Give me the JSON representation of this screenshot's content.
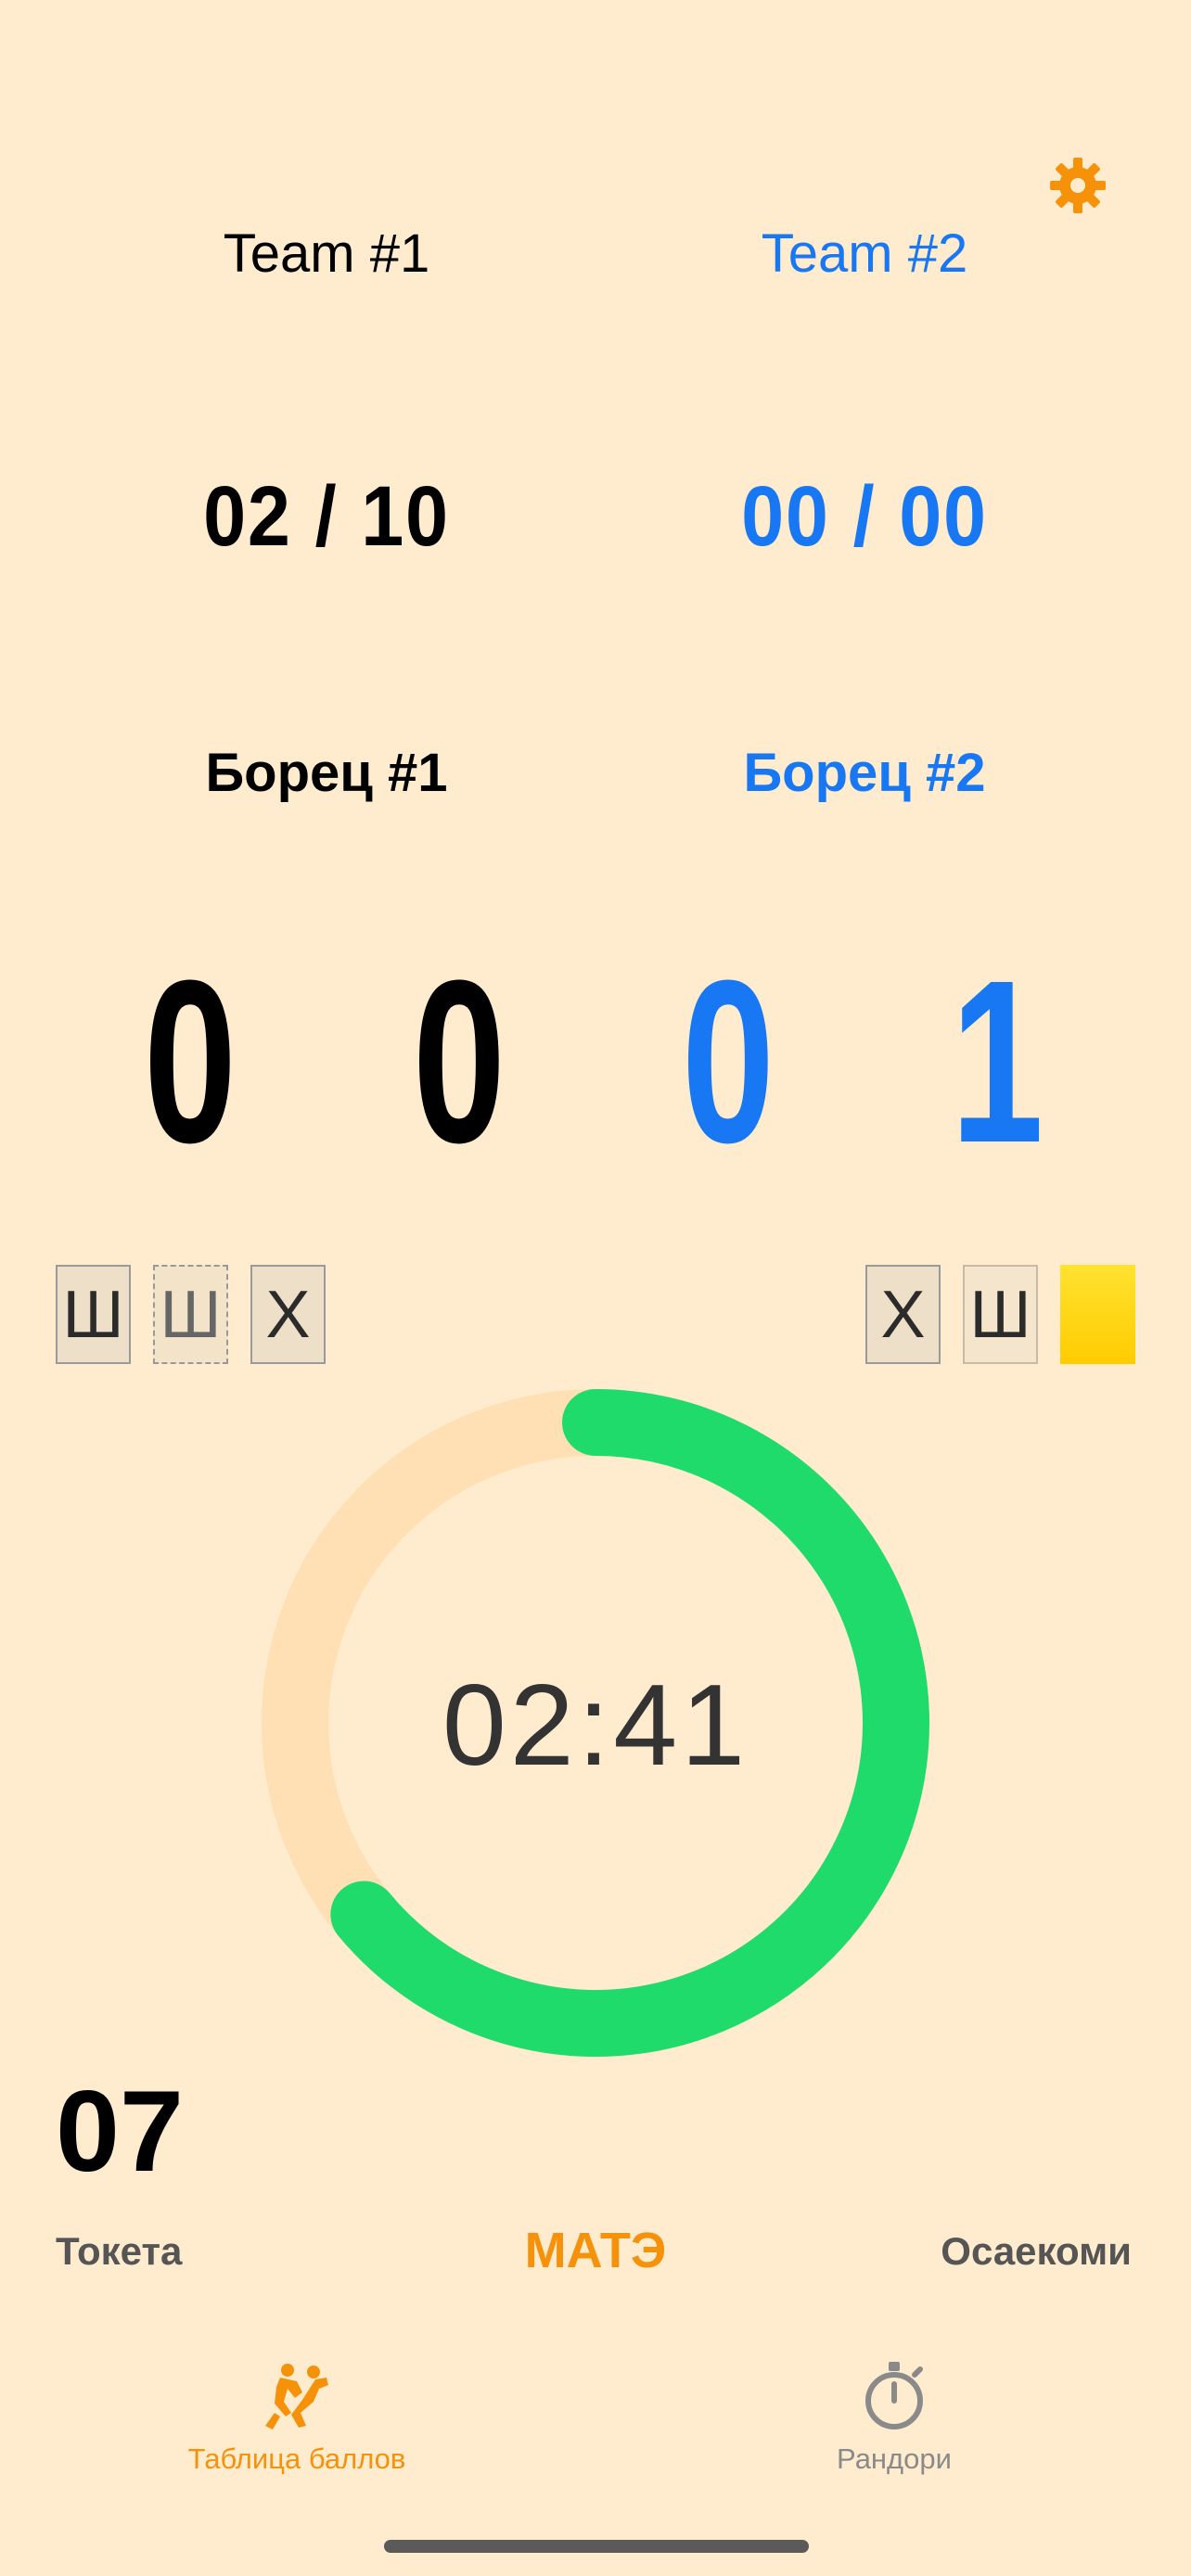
{
  "settings": {
    "icon": "gear-icon",
    "color": "#F5920A"
  },
  "teams": [
    {
      "name": "Team #1",
      "color": "#000000"
    },
    {
      "name": "Team #2",
      "color": "#1877F2"
    }
  ],
  "match_scores": [
    "02 / 10",
    "00 / 00"
  ],
  "fighters": [
    "Борец #1",
    "Борец #2"
  ],
  "score_digits": {
    "fighter1": [
      "0",
      "0"
    ],
    "fighter2": [
      "0",
      "1"
    ]
  },
  "penalties": {
    "left": [
      "Ш",
      "Ш",
      "Х"
    ],
    "right": [
      "Х",
      "Ш"
    ],
    "right_card": "yellow"
  },
  "timer": {
    "value": "02:41",
    "progress": 0.64,
    "track_color": "#FFDFB4",
    "progress_color": "#1FDB6B"
  },
  "counter": "07",
  "controls": {
    "left": "Токета",
    "center": "МАТЭ",
    "right": "Осаекоми"
  },
  "tabs": [
    {
      "label": "Таблица баллов",
      "icon": "wrestlers-icon",
      "active": true
    },
    {
      "label": "Рандори",
      "icon": "stopwatch-icon",
      "active": false
    }
  ]
}
